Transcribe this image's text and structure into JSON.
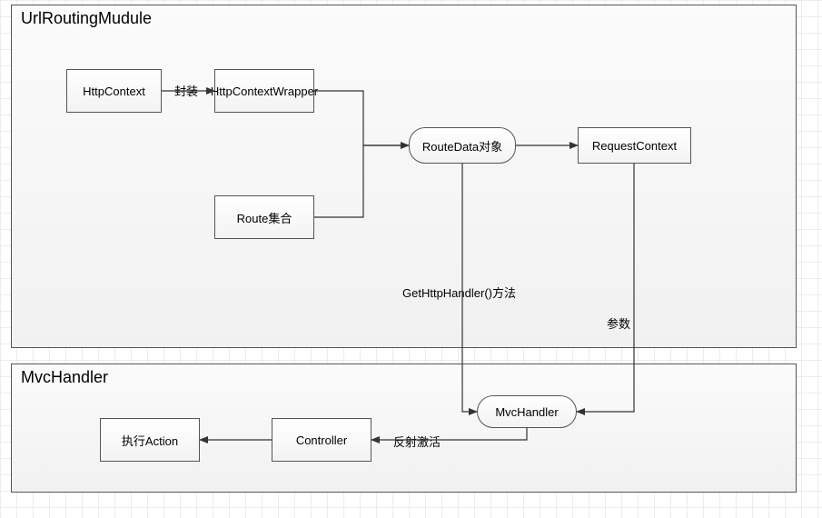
{
  "groups": {
    "url_routing_module": {
      "title": "UrlRoutingMudule"
    },
    "mvc_handler_group": {
      "title": "MvcHandler"
    }
  },
  "nodes": {
    "http_context": "HttpContext",
    "http_context_wrapper": "HttpContextWrapper",
    "route_collection": "Route集合",
    "route_data": "RouteData对象",
    "request_context": "RequestContext",
    "mvc_handler": "MvcHandler",
    "controller": "Controller",
    "execute_action": "执行Action"
  },
  "edges": {
    "wrap": "封装",
    "get_http_handler": "GetHttpHandler()方法",
    "param": "参数",
    "reflect_activate": "反射激活"
  }
}
